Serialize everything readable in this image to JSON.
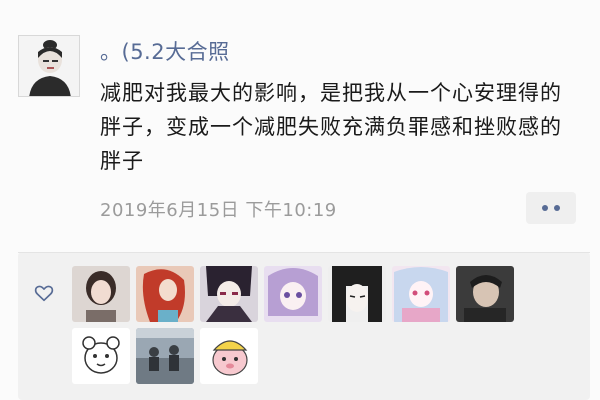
{
  "post": {
    "username": "。(5.2大合照",
    "content": "减肥对我最大的影响，是把我从一个心安理得的胖子，变成一个减肥失败充满负罪感和挫败感的胖子",
    "timestamp": "2019年6月15日 下午10:19"
  },
  "icons": {
    "like": "heart-outline-icon",
    "more": "more-dots-icon"
  },
  "colors": {
    "username": "#576b95",
    "content": "#1a1a1a",
    "timestamp": "#9b9b9b",
    "likes_background": "#f1f1f1"
  },
  "likers": [
    {
      "name": "liker-avatar-1"
    },
    {
      "name": "liker-avatar-2"
    },
    {
      "name": "liker-avatar-3"
    },
    {
      "name": "liker-avatar-4"
    },
    {
      "name": "liker-avatar-5"
    },
    {
      "name": "liker-avatar-6"
    },
    {
      "name": "liker-avatar-7"
    },
    {
      "name": "liker-avatar-8"
    },
    {
      "name": "liker-avatar-9"
    },
    {
      "name": "liker-avatar-10"
    }
  ]
}
